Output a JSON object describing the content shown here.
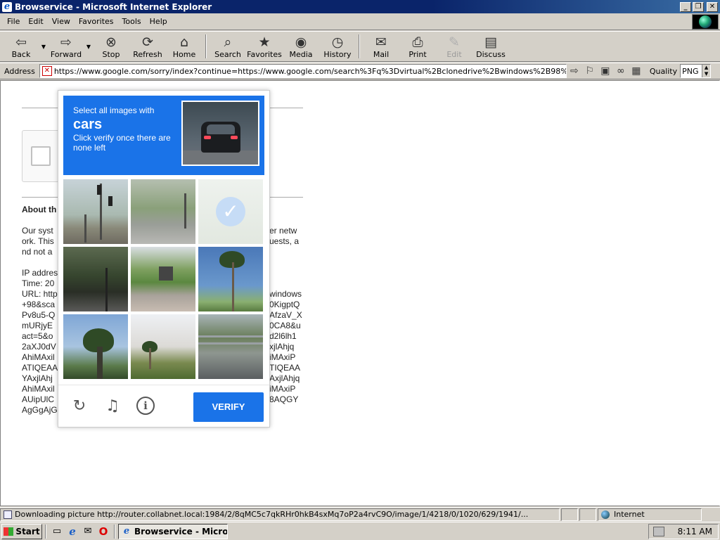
{
  "window": {
    "title": "Browservice - Microsoft Internet Explorer"
  },
  "menu": [
    {
      "name": "file",
      "label": "File"
    },
    {
      "name": "edit",
      "label": "Edit"
    },
    {
      "name": "view",
      "label": "View"
    },
    {
      "name": "favorites",
      "label": "Favorites"
    },
    {
      "name": "tools",
      "label": "Tools"
    },
    {
      "name": "help",
      "label": "Help"
    }
  ],
  "toolbar": {
    "back": "Back",
    "forward": "Forward",
    "stop": "Stop",
    "refresh": "Refresh",
    "home": "Home",
    "search": "Search",
    "favorites": "Favorites",
    "media": "Media",
    "history": "History",
    "mail": "Mail",
    "print": "Print",
    "edit": "Edit",
    "discuss": "Discuss"
  },
  "address": {
    "label": "Address",
    "url": "https://www.google.com/sorry/index?continue=https://www.google.com/search%3Fq%3Dvirtual%2Bclonedrive%2Bwindows%2B98%",
    "quality_label": "Quality",
    "quality_value": "PNG"
  },
  "page": {
    "about_heading": "About th",
    "para": [
      "Our syst",
      "ork. This",
      "nd not a"
    ],
    "para_right": [
      "er netw",
      "uests, a"
    ],
    "meta_left": [
      "IP addres",
      "Time: 20",
      "URL: http",
      "+98&sca",
      "Pv8u5-Q",
      "mURjyE",
      "act=5&o",
      "2aXJ0dV",
      "AhiMAxil",
      "ATIQEAA",
      "YAxjlAhj",
      "AhiMAxil",
      "AUipUlC",
      "AgGgAjG"
    ],
    "meta_right": [
      "windows",
      "0KigptQ",
      "AfzaV_X",
      "0CA8&u",
      "d2l6lh1",
      "xjlAhjq",
      "iMAxiP",
      "TIQEAA",
      "AxjlAhjq",
      "iMAxiP",
      "8AQGY"
    ]
  },
  "captcha": {
    "instruction": "Select all images with",
    "target": "cars",
    "subtext": "Click verify once there are none left",
    "verify_label": "VERIFY",
    "colors": {
      "header": "#1a73e8",
      "button": "#1a73e8"
    }
  },
  "status": {
    "text": "Downloading picture http://router.collabnet.local:1984/2/8qMC5c7qkRHr0hkB4sxMq7oP2a4rvC9O/image/1/4218/0/1020/629/1941/...",
    "zone": "Internet"
  },
  "taskbar": {
    "start_label": "Start",
    "task_label": "Browservice - Micro...",
    "clock": "8:11 AM"
  }
}
